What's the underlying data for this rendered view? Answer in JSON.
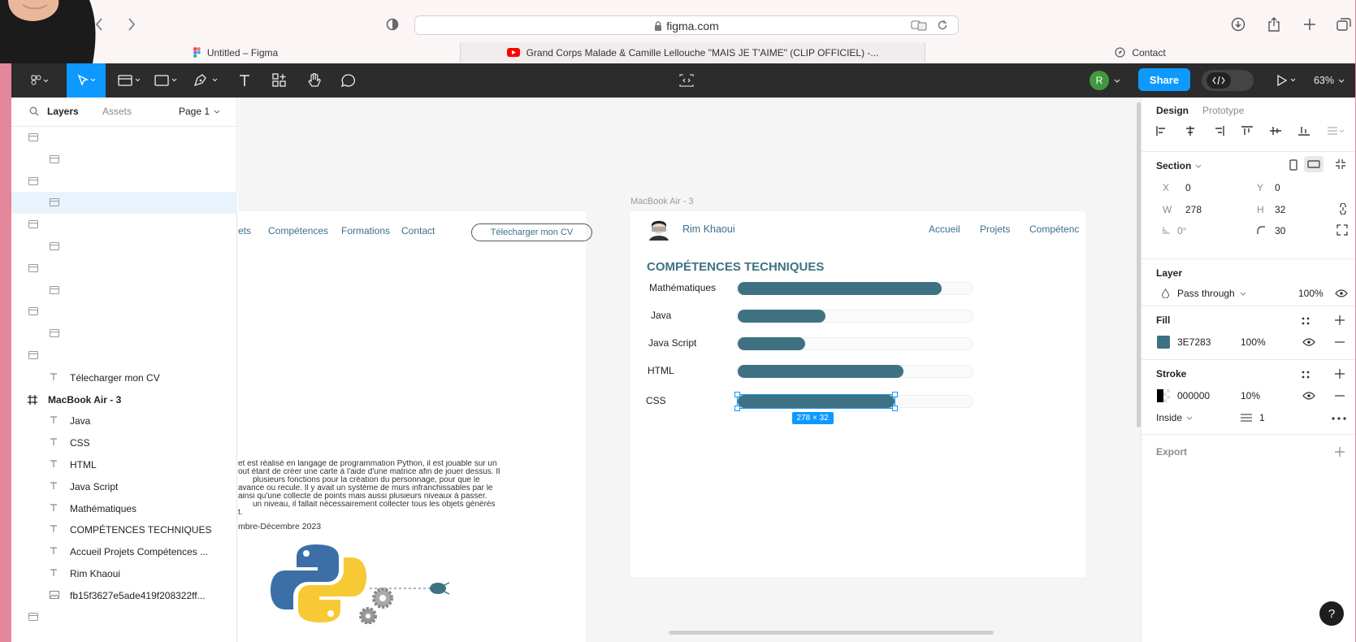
{
  "browser": {
    "url": "figma.com",
    "tabs": [
      {
        "label": "Untitled – Figma"
      },
      {
        "label": "Grand Corps Malade & Camille Lellouche \"MAIS JE T'AIME\" (CLIP OFFICIEL) -..."
      },
      {
        "label": "Contact"
      }
    ]
  },
  "toolbar": {
    "share_label": "Share",
    "user_initial": "R",
    "zoom": "63%"
  },
  "left_panel": {
    "tab_layers": "Layers",
    "tab_assets": "Assets",
    "page": "Page 1",
    "layers": [
      {
        "type": "section",
        "indent": 0,
        "label": ""
      },
      {
        "type": "section",
        "indent": 1,
        "label": ""
      },
      {
        "type": "section",
        "indent": 0,
        "label": ""
      },
      {
        "type": "section",
        "indent": 1,
        "label": "",
        "selected": true
      },
      {
        "type": "section",
        "indent": 0,
        "label": ""
      },
      {
        "type": "section",
        "indent": 1,
        "label": ""
      },
      {
        "type": "section",
        "indent": 0,
        "label": ""
      },
      {
        "type": "section",
        "indent": 1,
        "label": ""
      },
      {
        "type": "section",
        "indent": 0,
        "label": ""
      },
      {
        "type": "section",
        "indent": 1,
        "label": ""
      },
      {
        "type": "section",
        "indent": 0,
        "label": ""
      },
      {
        "type": "text",
        "indent": 1,
        "label": "Télecharger mon CV"
      },
      {
        "type": "frame",
        "indent": 0,
        "label": "MacBook Air - 3"
      },
      {
        "type": "text",
        "indent": 1,
        "label": "Java"
      },
      {
        "type": "text",
        "indent": 1,
        "label": "CSS"
      },
      {
        "type": "text",
        "indent": 1,
        "label": "HTML"
      },
      {
        "type": "text",
        "indent": 1,
        "label": "Java Script"
      },
      {
        "type": "text",
        "indent": 1,
        "label": "Mathématiques"
      },
      {
        "type": "text",
        "indent": 1,
        "label": "COMPÉTENCES TECHNIQUES"
      },
      {
        "type": "text",
        "indent": 1,
        "label": "Accueil Projets Compétences ..."
      },
      {
        "type": "text",
        "indent": 1,
        "label": "Rim Khaoui"
      },
      {
        "type": "image",
        "indent": 1,
        "label": "fb15f3627e5ade419f208322ff..."
      },
      {
        "type": "section",
        "indent": 0,
        "label": ""
      }
    ]
  },
  "canvas": {
    "page1": {
      "nav": [
        "ets",
        "Compétences",
        "Formations",
        "Contact"
      ],
      "cv_button": "Télecharger mon CV",
      "paragraph_lines": [
        "et est réalisé en langage de programmation Python, il est jouable sur un",
        "out étant de créer une carte à l'aide d'une matrice afin de jouer dessus. Il",
        "plusieurs fonctions pour la création du personnage, pour que le",
        "avance ou recule. Il y avait un système de murs infranchissables par le",
        "ainsi qu'une collecte de points mais aussi plusieurs niveaux à passer.",
        "un niveau, il fallait nécessairement collecter tous les objets générés",
        "t."
      ],
      "date": "mbre-Décembre 2023"
    },
    "page2": {
      "frame_label": "MacBook Air - 3",
      "name": "Rim Khaoui",
      "nav": [
        "Accueil",
        "Projets",
        "Compétenc"
      ],
      "heading": "COMPÉTENCES TECHNIQUES",
      "skills": [
        {
          "label": "Mathématiques",
          "level": 0.86
        },
        {
          "label": "Java",
          "level": 0.37
        },
        {
          "label": "Java Script",
          "level": 0.285
        },
        {
          "label": "HTML",
          "level": 0.7
        },
        {
          "label": "CSS",
          "level": 0.66
        }
      ],
      "selection_size": "278 × 32"
    }
  },
  "right_panel": {
    "tab_design": "Design",
    "tab_prototype": "Prototype",
    "section_label": "Section",
    "x_label": "X",
    "x": "0",
    "y_label": "Y",
    "y": "0",
    "w_label": "W",
    "w": "278",
    "h_label": "H",
    "h": "32",
    "rotation": "0°",
    "radius": "30",
    "layer_title": "Layer",
    "blend": "Pass through",
    "opacity": "100%",
    "fill_title": "Fill",
    "fill_hex": "3E7283",
    "fill_opacity": "100%",
    "fill_color": "#3e7283",
    "stroke_title": "Stroke",
    "stroke_hex": "000000",
    "stroke_opacity": "10%",
    "stroke_position": "Inside",
    "stroke_weight": "1",
    "export_title": "Export"
  },
  "help_label": "?"
}
